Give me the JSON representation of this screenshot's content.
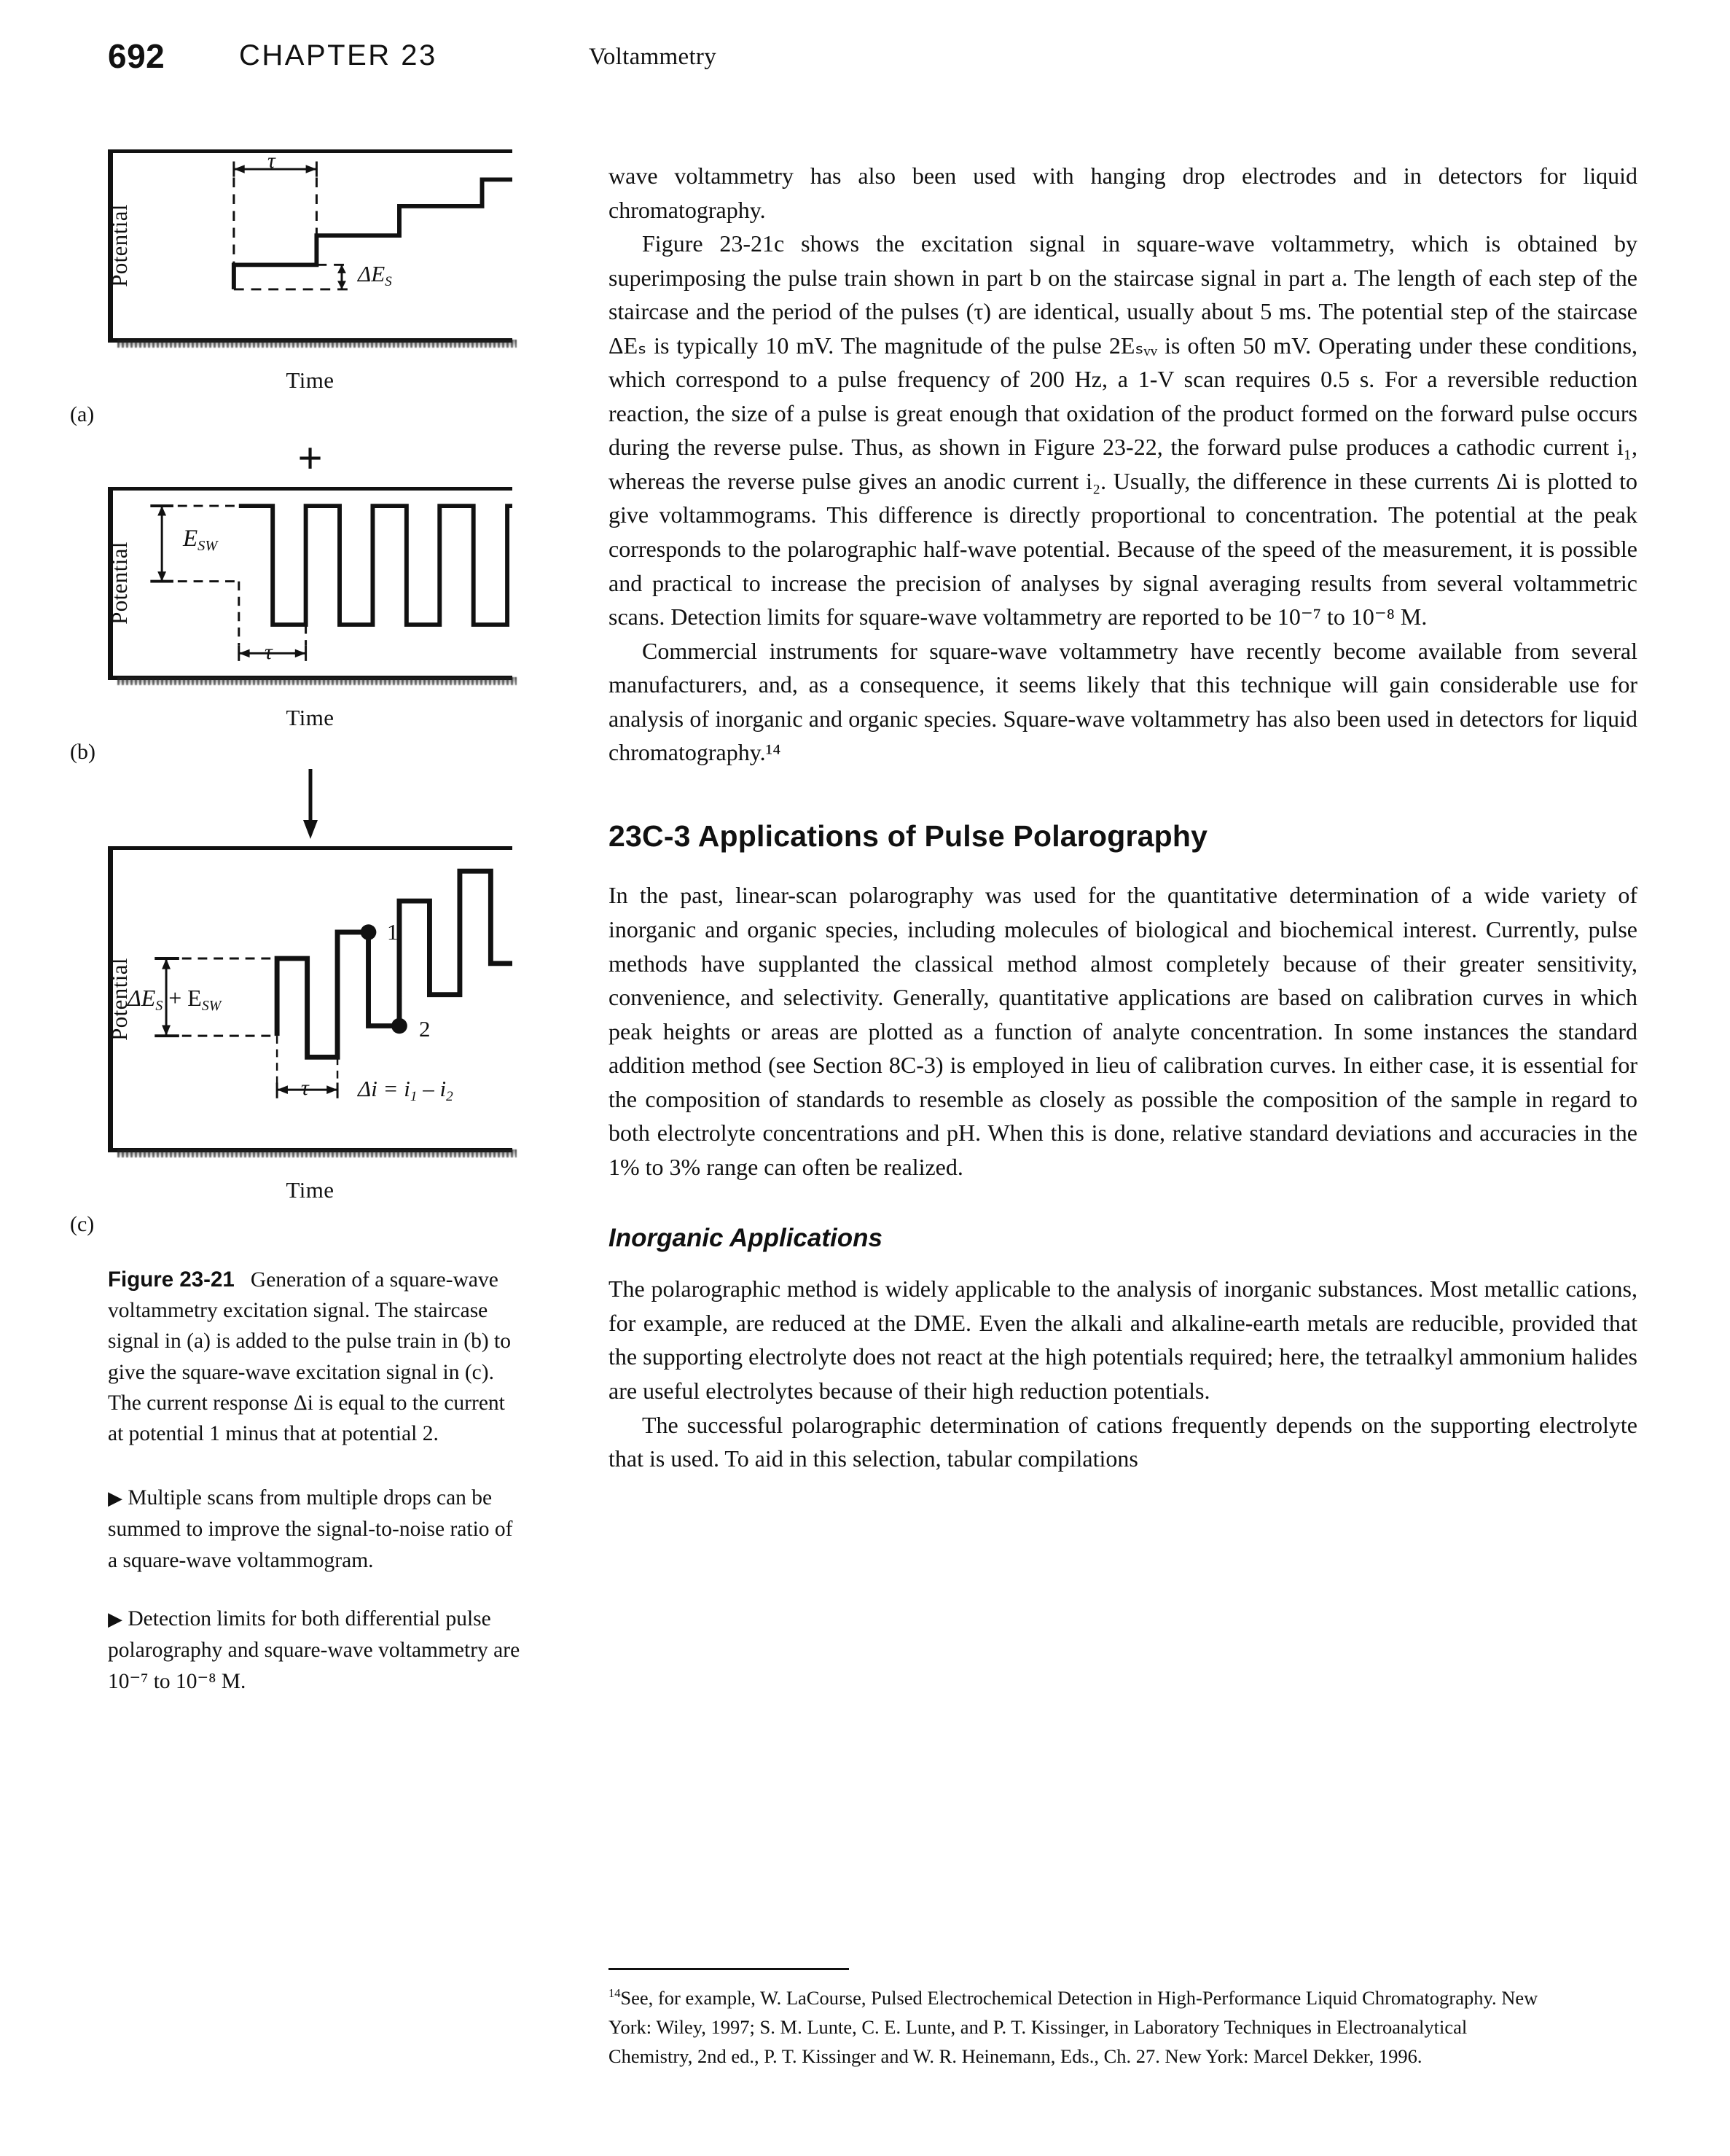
{
  "running_head": {
    "folio": "692",
    "chapter": "CHAPTER 23",
    "title": "Voltammetry"
  },
  "figure": {
    "panels": [
      {
        "letter": "(a)",
        "y_axis_label": "Potential",
        "x_axis_label": "Time",
        "annotations": {
          "period": "τ",
          "step": "ΔE",
          "step_sub": "S"
        }
      },
      {
        "letter": "(b)",
        "y_axis_label": "Potential",
        "x_axis_label": "Time",
        "annotations": {
          "amplitude": "E",
          "amplitude_sub": "SW",
          "period": "τ"
        }
      },
      {
        "letter": "(c)",
        "y_axis_label": "Potential",
        "x_axis_label": "Time",
        "annotations": {
          "combined": "ΔE",
          "combined_sub1": "S",
          "combined_plus": " + E",
          "combined_sub2": "SW",
          "period": "τ",
          "point1": "1",
          "point2": "2",
          "delta_i": "Δi = i",
          "delta_i_sub1": "1",
          "delta_i_minus": " – i",
          "delta_i_sub2": "2"
        }
      }
    ],
    "operator_plus": "+",
    "caption_label": "Figure 23-21",
    "caption_text": "Generation of a square-wave voltammetry excitation signal. The staircase signal in (a) is added to the pulse train in (b) to give the square-wave excitation signal in (c). The current response Δi is equal to the current at potential 1 minus that at potential 2."
  },
  "margin_notes": [
    {
      "marker": "▶",
      "text": "Multiple scans from multiple drops can be summed to improve the signal-to-noise ratio of a square-wave voltammogram."
    },
    {
      "marker": "▶",
      "text": "Detection limits for both differential pulse polarography and square-wave voltammetry are 10⁻⁷ to 10⁻⁸ M."
    }
  ],
  "body": {
    "paragraphs": [
      {
        "id": "p-continued",
        "indent": false,
        "text": "wave voltammetry has also been used with hanging drop electrodes and in detectors for liquid chromatography."
      },
      {
        "id": "p-fig2321c",
        "indent": true,
        "text": "Figure 23-21c shows the excitation signal in square-wave voltammetry, which is obtained by superimposing the pulse train shown in part b on the staircase signal in part a. The length of each step of the staircase and the period of the pulses (τ) are identical, usually about 5 ms. The potential step of the staircase ΔEₛ is typically 10 mV. The magnitude of the pulse 2Eₛᵥᵥ is often 50 mV. Operating under these conditions, which correspond to a pulse frequency of 200 Hz, a 1-V scan requires 0.5 s. For a reversible reduction reaction, the size of a pulse is great enough that oxidation of the product formed on the forward pulse occurs during the reverse pulse. Thus, as shown in Figure 23-22, the forward pulse produces a cathodic current i₁, whereas the reverse pulse gives an anodic current i₂. Usually, the difference in these currents Δi is plotted to give voltammograms. This difference is directly proportional to concentration. The potential at the peak corresponds to the polarographic half-wave potential. Because of the speed of the measurement, it is possible and practical to increase the precision of analyses by signal averaging results from several voltammetric scans. Detection limits for square-wave voltammetry are reported to be 10⁻⁷ to 10⁻⁸ M."
      },
      {
        "id": "p-commercial",
        "indent": true,
        "text": "Commercial instruments for square-wave voltammetry have recently become available from several manufacturers, and, as a consequence, it seems likely that this technique will gain considerable use for analysis of inorganic and organic species. Square-wave voltammetry has also been used in detectors for liquid chromatography.¹⁴"
      }
    ],
    "section_heading": "23C-3 Applications of Pulse Polarography",
    "section_paragraphs": [
      {
        "id": "p-inpast",
        "indent": false,
        "text": "In the past, linear-scan polarography was used for the quantitative determination of a wide variety of inorganic and organic species, including molecules of biological and biochemical interest. Currently, pulse methods have supplanted the classical method almost completely because of their greater sensitivity, convenience, and selectivity. Generally, quantitative applications are based on calibration curves in which peak heights or areas are plotted as a function of analyte concentration. In some instances the standard addition method (see Section 8C-3) is employed in lieu of calibration curves. In either case, it is essential for the composition of standards to resemble as closely as possible the composition of the sample in regard to both electrolyte concentrations and pH. When this is done, relative standard deviations and accuracies in the 1% to 3% range can often be realized."
      }
    ],
    "subsection_heading": "Inorganic Applications",
    "subsection_paragraphs": [
      {
        "id": "p-polmethod",
        "indent": false,
        "text": "The polarographic method is widely applicable to the analysis of inorganic substances. Most metallic cations, for example, are reduced at the DME. Even the alkali and alkaline-earth metals are reducible, provided that the supporting electrolyte does not react at the high potentials required; here, the tetraalkyl ammonium halides are useful electrolytes because of their high reduction potentials."
      },
      {
        "id": "p-successful",
        "indent": true,
        "text": "The successful polarographic determination of cations frequently depends on the supporting electrolyte that is used. To aid in this selection, tabular compilations"
      }
    ]
  },
  "footnote": {
    "marker": "14",
    "text": "See, for example, W. LaCourse, Pulsed Electrochemical Detection in High-Performance Liquid Chromatography. New York: Wiley, 1997; S. M. Lunte, C. E. Lunte, and P. T. Kissinger, in Laboratory Techniques in Electroanalytical Chemistry, 2nd ed., P. T. Kissinger and W. R. Heinemann, Eds., Ch. 27. New York: Marcel Dekker, 1996."
  },
  "colors": {
    "ink": "#111111",
    "paper": "#ffffff"
  }
}
